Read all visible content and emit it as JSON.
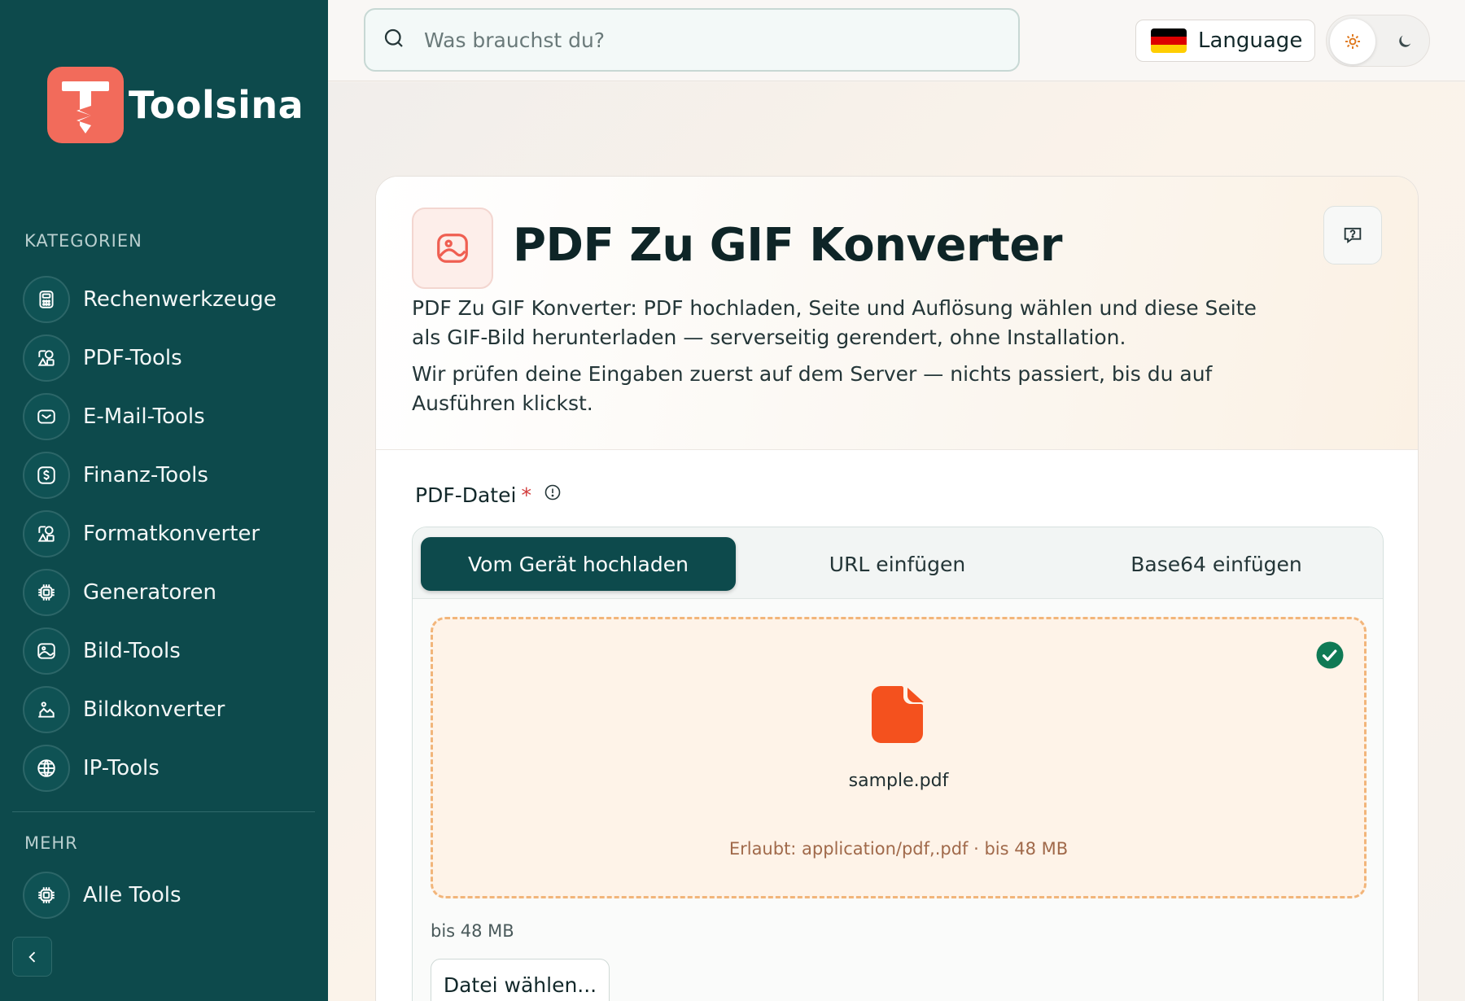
{
  "brand": {
    "name": "Toolsina"
  },
  "sidebar": {
    "categories_title": "KATEGORIEN",
    "items": [
      {
        "label": "Rechenwerkzeuge",
        "icon": "calculator-icon"
      },
      {
        "label": "PDF-Tools",
        "icon": "shapes-icon"
      },
      {
        "label": "E-Mail-Tools",
        "icon": "mail-icon"
      },
      {
        "label": "Finanz-Tools",
        "icon": "dollar-icon"
      },
      {
        "label": "Formatkonverter",
        "icon": "shapes-icon"
      },
      {
        "label": "Generatoren",
        "icon": "cpu-icon"
      },
      {
        "label": "Bild-Tools",
        "icon": "image-icon"
      },
      {
        "label": "Bildkonverter",
        "icon": "image-convert-icon"
      },
      {
        "label": "IP-Tools",
        "icon": "globe-icon"
      }
    ],
    "more_title": "MEHR",
    "more_items": [
      {
        "label": "Alle Tools",
        "icon": "cpu-icon"
      }
    ]
  },
  "topbar": {
    "search_placeholder": "Was brauchst du?",
    "language_label": "Language"
  },
  "tool": {
    "title": "PDF Zu GIF Konverter",
    "description_1": "PDF Zu GIF Konverter: PDF hochladen, Seite und Auflösung wählen und diese Seite als GIF-Bild herunterladen — serverseitig gerendert, ohne Installation.",
    "description_2": "Wir prüfen deine Eingaben zuerst auf dem Server — nichts passiert, bis du auf Ausführen klickst.",
    "field_label": "PDF-Datei",
    "required_mark": "*",
    "tabs": [
      {
        "label": "Vom Gerät hochladen",
        "active": true
      },
      {
        "label": "URL einfügen",
        "active": false
      },
      {
        "label": "Base64 einfügen",
        "active": false
      }
    ],
    "file_name": "sample.pdf",
    "allowed_text": "Erlaubt: application/pdf,.pdf · bis 48 MB",
    "size_note": "bis 48 MB",
    "choose_button": "Datei wählen..."
  },
  "colors": {
    "sidebar_bg": "#0d4a4c",
    "accent": "#f26b5b",
    "file_icon": "#f4511e",
    "success": "#0f7a55"
  }
}
